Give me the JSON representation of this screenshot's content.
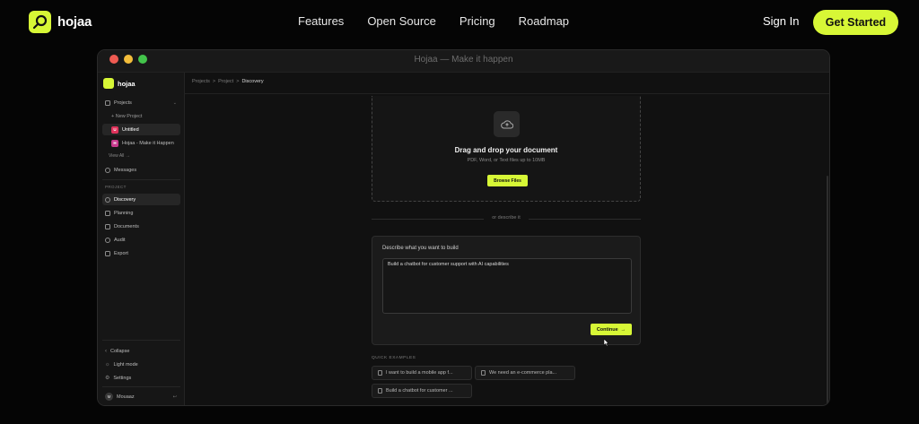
{
  "nav": {
    "logo": "hojaa",
    "links": [
      "Features",
      "Open Source",
      "Pricing",
      "Roadmap"
    ],
    "sign_in": "Sign In",
    "get_started": "Get Started"
  },
  "window": {
    "title": "Hojaa — Make it happen"
  },
  "sidebar": {
    "logo": "hojaa",
    "projects_label": "Projects",
    "new_project": "+ New Project",
    "projects": [
      {
        "label": "Untitled",
        "badge": "U",
        "color": "#e0335c"
      },
      {
        "label": "Hojaa - Make it Happen",
        "badge": "H",
        "color": "#c83a8d"
      }
    ],
    "view_all": "View All →",
    "messages": "Messages",
    "section": "PROJECT",
    "items": [
      "Discovery",
      "Planning",
      "Documents",
      "Audit",
      "Export"
    ],
    "collapse": "Collapse",
    "light_mode": "Light mode",
    "settings": "Settings",
    "user_initial": "M",
    "user_name": "Mouaaz"
  },
  "breadcrumb": {
    "a": "Projects",
    "b": "Project",
    "c": "Discovery",
    "sep": ">"
  },
  "upload": {
    "title": "Drag and drop your document",
    "subtitle": "PDF, Word, or Text files up to 10MB",
    "button": "Browse Files"
  },
  "divider_text": "or describe it",
  "describe": {
    "label": "Describe what you want to build",
    "value": "Build a chatbot for customer support with AI capabilities",
    "continue": "Continue"
  },
  "quick_examples": {
    "title": "QUICK EXAMPLES",
    "items": [
      "I want to build a mobile app f...",
      "We need an e-commerce pla...",
      "Build a chatbot for customer ..."
    ]
  },
  "colors": {
    "accent": "#d7f736",
    "bg": "#050505"
  }
}
